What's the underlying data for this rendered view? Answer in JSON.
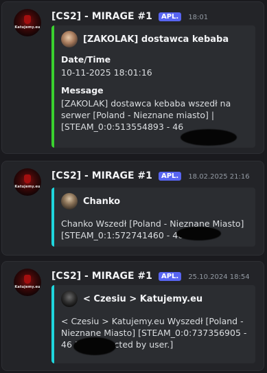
{
  "messages": [
    {
      "author": "[CS2] - MIRAGE #1",
      "badge": "APL.",
      "timestamp": "18:01",
      "bar_color": "#3ad12f",
      "avatar_text": "Katujemy.eu",
      "embed": {
        "author_name": "[ZAKOLAK] dostawca kebaba",
        "fields": [
          {
            "name": "Date/Time",
            "value": "10-11-2025 18:01:16"
          },
          {
            "name": "Message",
            "value": "[ZAKOLAK] dostawca kebaba wszedł na serwer [Poland - Nieznane miasto] | [STEAM_0:0:513554893 - 46"
          }
        ]
      }
    },
    {
      "author": "[CS2] - MIRAGE #1",
      "badge": "APL.",
      "timestamp": "18.02.2025 21:16",
      "bar_color": "#1fd6dd",
      "avatar_text": "Katujemy.eu",
      "embed": {
        "author_name": "Chanko",
        "description": "Chanko Wszedł [Poland - Nieznane Miasto] [STEAM_0:1:572741460 - 46"
      }
    },
    {
      "author": "[CS2] - MIRAGE #1",
      "badge": "APL.",
      "timestamp": "25.10.2024 18:54",
      "bar_color": "#1fd6dd",
      "avatar_text": "Katujemy.eu",
      "embed": {
        "author_name": "< Czesiu > Katujemy.eu",
        "description": "< Czesiu > Katujemy.eu Wyszedł [Poland - Nieznane Miasto] [STEAM_0:0:737356905 - 46 Disconnected by user.]"
      }
    }
  ]
}
